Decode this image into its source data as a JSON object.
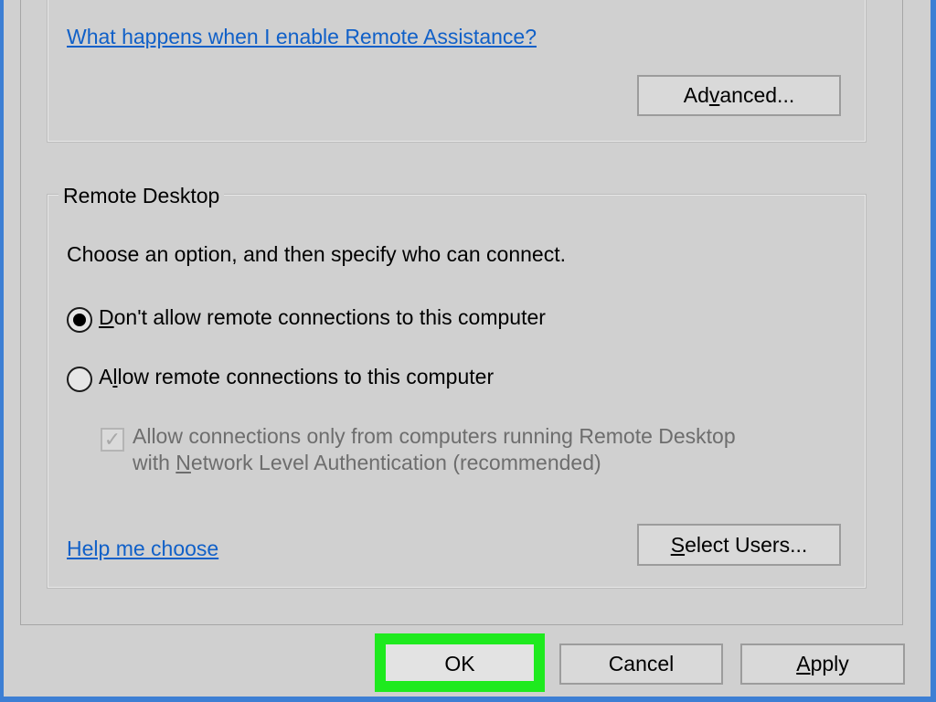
{
  "remote_assistance": {
    "help_link": "What happens when I enable Remote Assistance?",
    "advanced_button": {
      "pre": "Ad",
      "accel": "v",
      "post": "anced..."
    }
  },
  "remote_desktop": {
    "legend": "Remote Desktop",
    "instruction": "Choose an option, and then specify who can connect.",
    "options": [
      {
        "accel": "D",
        "rest": "on't allow remote connections to this computer",
        "selected": true
      },
      {
        "pre": "A",
        "accel": "l",
        "rest": "low remote connections to this computer",
        "selected": false
      }
    ],
    "nla_checkbox": {
      "line1": "Allow connections only from computers running Remote Desktop",
      "line2_pre": "with ",
      "line2_accel": "N",
      "line2_post": "etwork Level Authentication (recommended)",
      "checked": true,
      "disabled": true
    },
    "help_link": "Help me choose",
    "select_users_button": {
      "accel": "S",
      "post": "elect Users..."
    }
  },
  "footer": {
    "ok": "OK",
    "cancel": "Cancel",
    "apply": {
      "accel": "A",
      "post": "pply"
    }
  },
  "colors": {
    "highlight": "#1eea1e",
    "window_frame": "#3d7fd4",
    "link": "#1060c8"
  },
  "icons": {
    "checkbox_mark": "✓"
  }
}
